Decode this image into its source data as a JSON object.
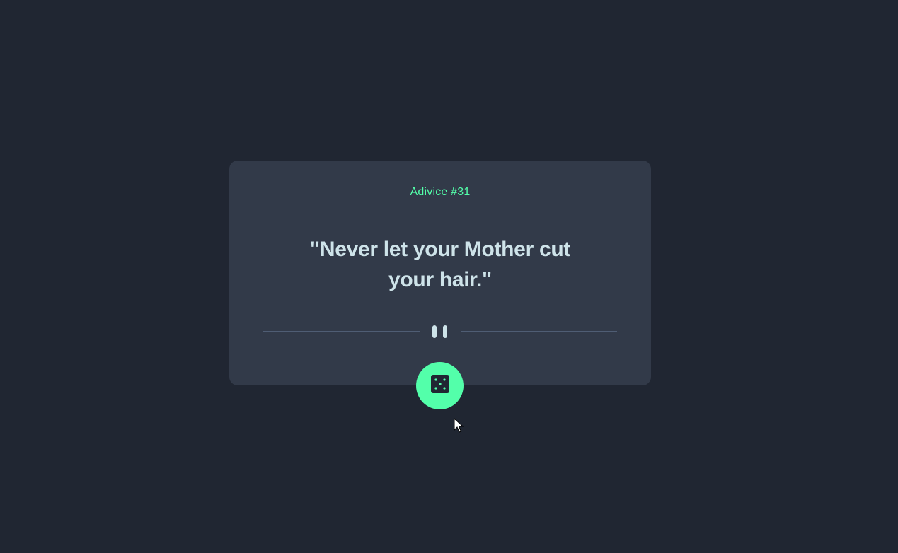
{
  "card": {
    "advice_label": "Adivice #31",
    "quote_text": "\"Never let your Mother cut your hair.\""
  },
  "divider": {
    "icon": "pause-icon"
  },
  "button": {
    "icon": "dice-icon",
    "aria_label": "Get new advice"
  },
  "colors": {
    "background": "#202632",
    "card": "#323a49",
    "accent": "#53ffaa",
    "text": "#cee3e9",
    "divider": "#4f5d74"
  }
}
